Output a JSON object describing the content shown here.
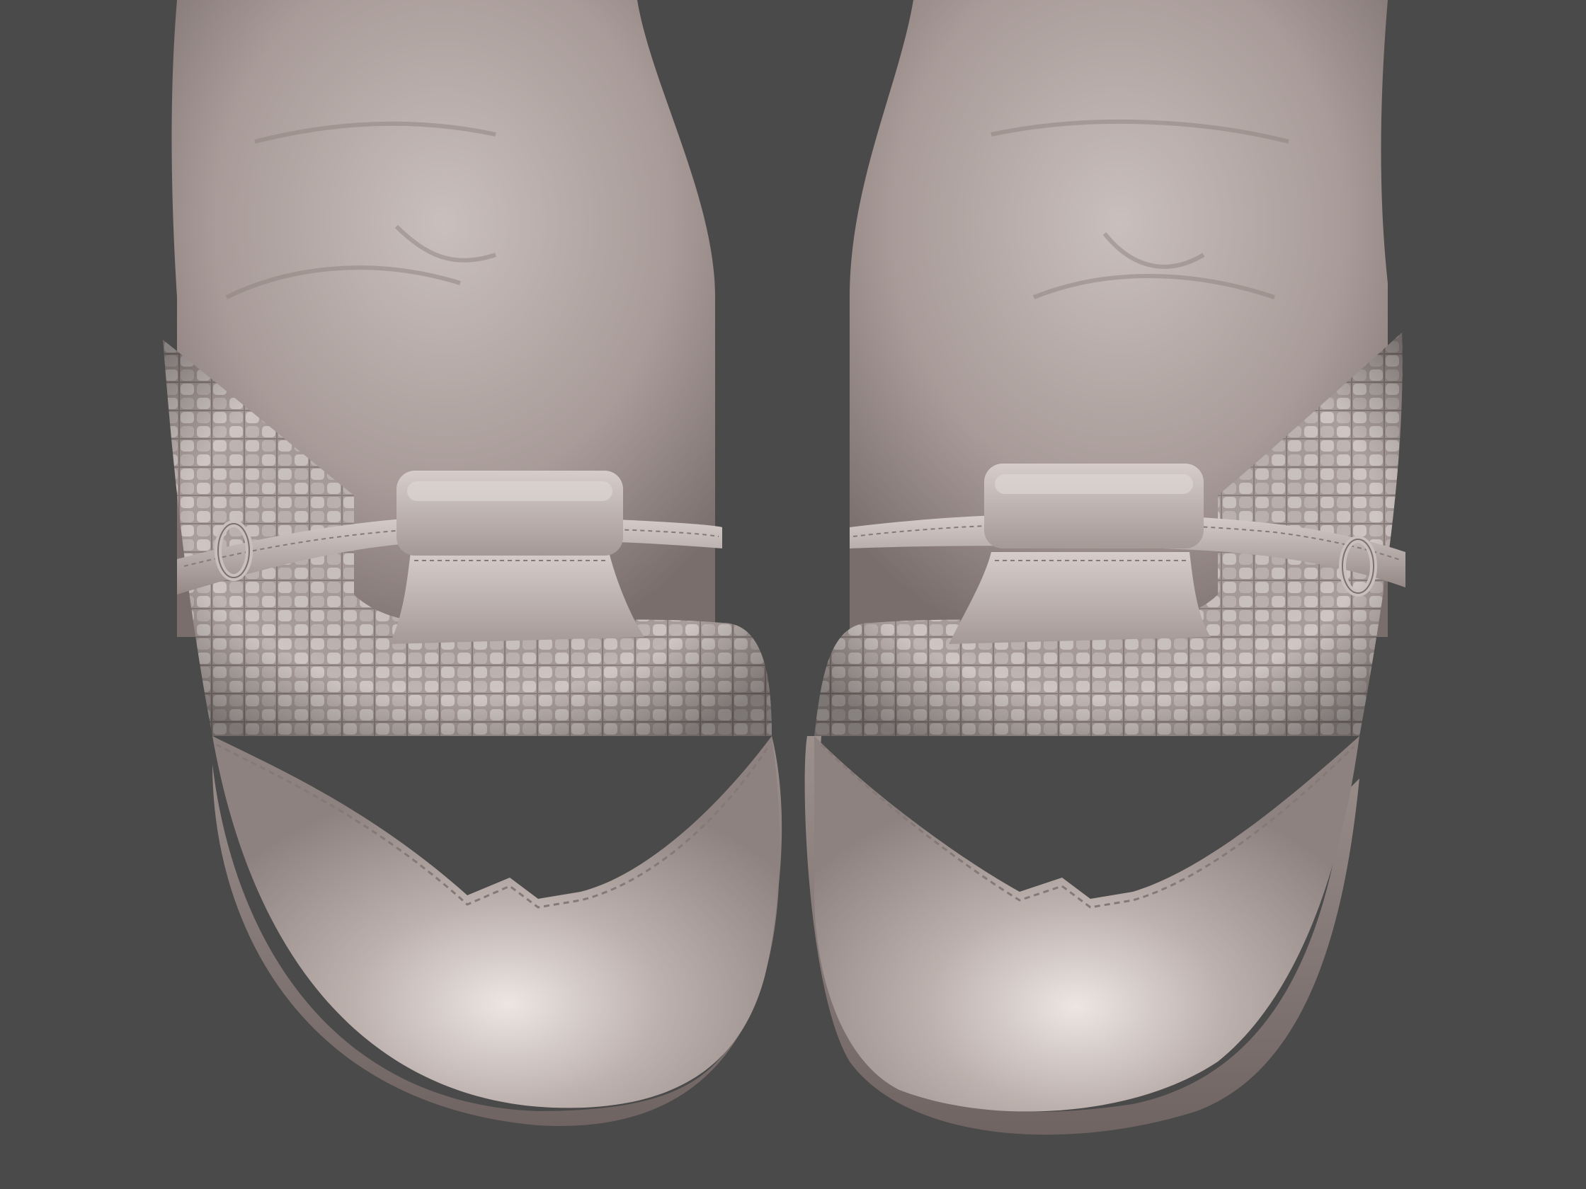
{
  "viewport": {
    "background": "#4a4a4a",
    "material": "#b6a9a6",
    "material_shadow": "#7d706e",
    "material_highlight": "#e6dedb"
  },
  "subjects": [
    {
      "name": "left-shoe",
      "parts": [
        "ankle",
        "woven-vamp",
        "toe-cap",
        "strap",
        "buckle",
        "tongue-tab",
        "sole"
      ]
    },
    {
      "name": "right-shoe",
      "parts": [
        "ankle",
        "woven-vamp",
        "toe-cap",
        "strap",
        "buckle",
        "tongue-tab",
        "sole"
      ]
    }
  ]
}
